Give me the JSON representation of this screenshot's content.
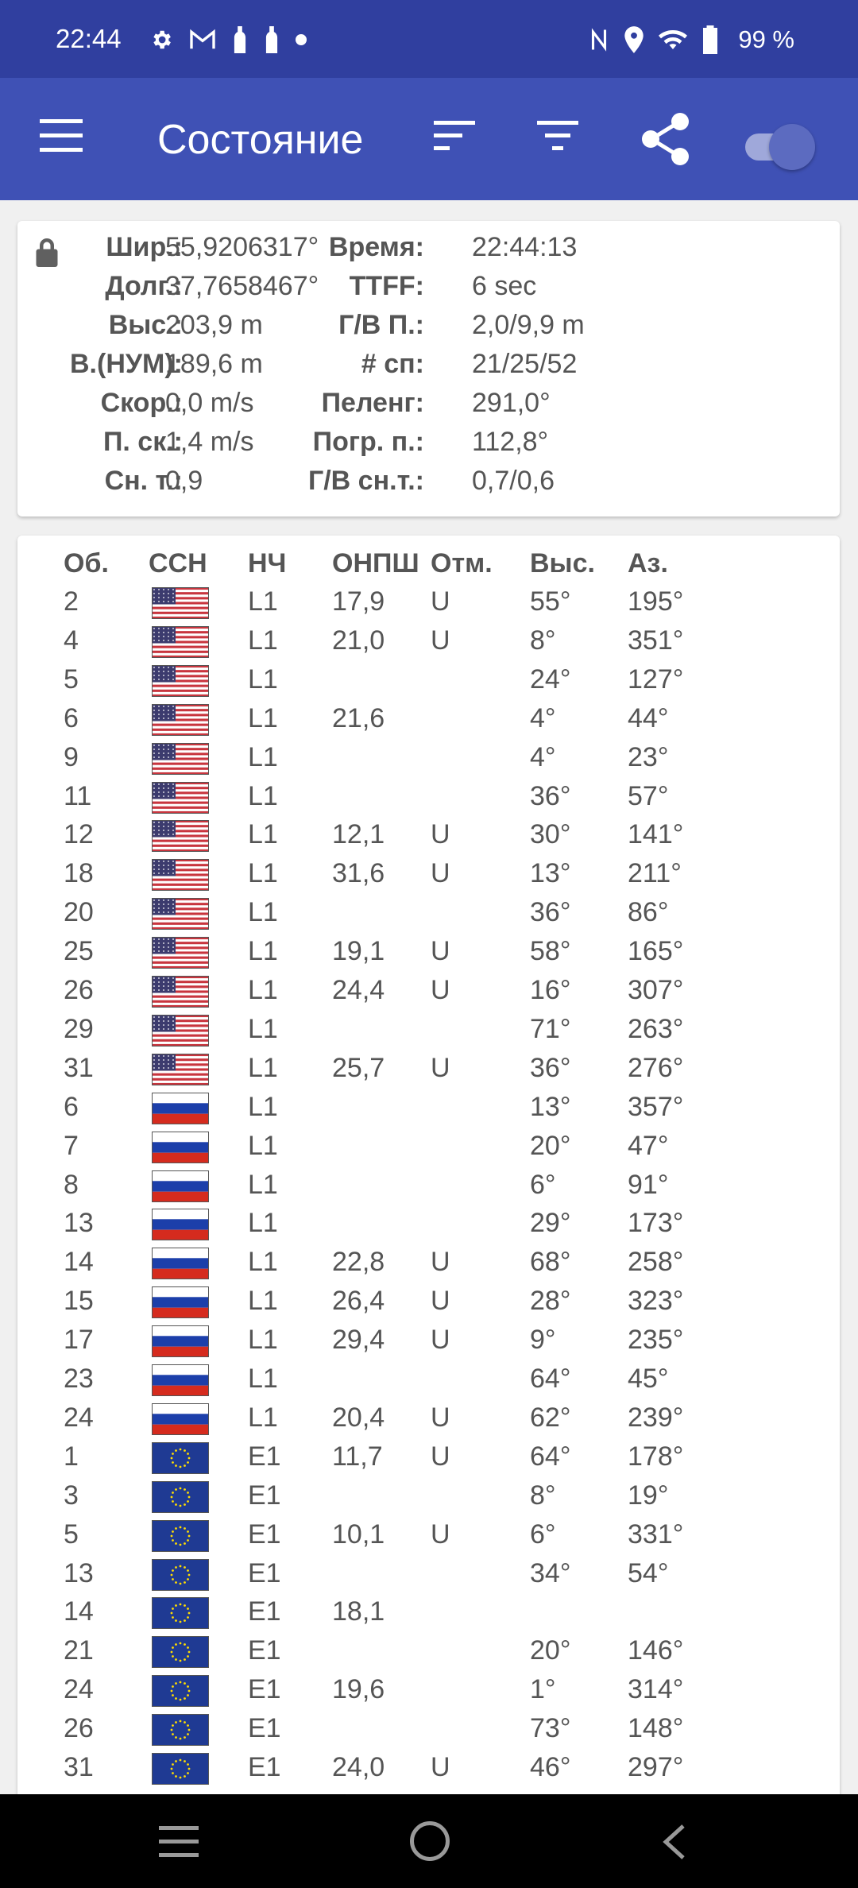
{
  "status_bar": {
    "time": "22:44",
    "battery": "99 %",
    "left_icons": [
      "gear-icon",
      "gmail-icon",
      "bottle-icon",
      "bottle-icon",
      "dot-icon"
    ],
    "right_icons": [
      "nfc-icon",
      "location-icon",
      "wifi-icon",
      "battery-icon"
    ]
  },
  "app_bar": {
    "title": "Состояние",
    "color": "#3f51b5",
    "status_color": "#303f9f",
    "actions": [
      "menu-icon",
      "sort-icon",
      "filter-icon",
      "share-icon",
      "toggle-switch"
    ],
    "toggle_on": true
  },
  "info": {
    "left": [
      {
        "label": "Шир.:",
        "value": "55,9206317°"
      },
      {
        "label": "Долг.:",
        "value": "37,7658467°"
      },
      {
        "label": "Выс.:",
        "value": "203,9 m"
      },
      {
        "label": "В.(НУМ):",
        "value": "189,6 m"
      },
      {
        "label": "Скор.:",
        "value": "0,0 m/s"
      },
      {
        "label": "П. ск.:",
        "value": "1,4 m/s"
      },
      {
        "label": "Сн. т.:",
        "value": "0,9"
      }
    ],
    "right": [
      {
        "label": "Время:",
        "value": "22:44:13"
      },
      {
        "label": "TTFF:",
        "value": "6 sec"
      },
      {
        "label": "Г/В П.:",
        "value": "2,0/9,9 m"
      },
      {
        "label": "# сп:",
        "value": "21/25/52"
      },
      {
        "label": "Пеленг:",
        "value": "291,0°"
      },
      {
        "label": "Погр. п.:",
        "value": "112,8°"
      },
      {
        "label": "Г/В сн.т.:",
        "value": "0,7/0,6"
      }
    ]
  },
  "satellites": {
    "headers": [
      "Об.",
      "ССН",
      "НЧ",
      "ОНПШ",
      "Отм.",
      "Выс.",
      "Аз."
    ],
    "rows": [
      {
        "id": "2",
        "gnss": "usa",
        "freq": "L1",
        "cn0": "17,9",
        "flag": "U",
        "elev": "55°",
        "azim": "195°"
      },
      {
        "id": "4",
        "gnss": "usa",
        "freq": "L1",
        "cn0": "21,0",
        "flag": "U",
        "elev": "8°",
        "azim": "351°"
      },
      {
        "id": "5",
        "gnss": "usa",
        "freq": "L1",
        "cn0": "",
        "flag": "",
        "elev": "24°",
        "azim": "127°"
      },
      {
        "id": "6",
        "gnss": "usa",
        "freq": "L1",
        "cn0": "21,6",
        "flag": "",
        "elev": "4°",
        "azim": "44°"
      },
      {
        "id": "9",
        "gnss": "usa",
        "freq": "L1",
        "cn0": "",
        "flag": "",
        "elev": "4°",
        "azim": "23°"
      },
      {
        "id": "11",
        "gnss": "usa",
        "freq": "L1",
        "cn0": "",
        "flag": "",
        "elev": "36°",
        "azim": "57°"
      },
      {
        "id": "12",
        "gnss": "usa",
        "freq": "L1",
        "cn0": "12,1",
        "flag": "U",
        "elev": "30°",
        "azim": "141°"
      },
      {
        "id": "18",
        "gnss": "usa",
        "freq": "L1",
        "cn0": "31,6",
        "flag": "U",
        "elev": "13°",
        "azim": "211°"
      },
      {
        "id": "20",
        "gnss": "usa",
        "freq": "L1",
        "cn0": "",
        "flag": "",
        "elev": "36°",
        "azim": "86°"
      },
      {
        "id": "25",
        "gnss": "usa",
        "freq": "L1",
        "cn0": "19,1",
        "flag": "U",
        "elev": "58°",
        "azim": "165°"
      },
      {
        "id": "26",
        "gnss": "usa",
        "freq": "L1",
        "cn0": "24,4",
        "flag": "U",
        "elev": "16°",
        "azim": "307°"
      },
      {
        "id": "29",
        "gnss": "usa",
        "freq": "L1",
        "cn0": "",
        "flag": "",
        "elev": "71°",
        "azim": "263°"
      },
      {
        "id": "31",
        "gnss": "usa",
        "freq": "L1",
        "cn0": "25,7",
        "flag": "U",
        "elev": "36°",
        "azim": "276°"
      },
      {
        "id": "6",
        "gnss": "russia",
        "freq": "L1",
        "cn0": "",
        "flag": "",
        "elev": "13°",
        "azim": "357°"
      },
      {
        "id": "7",
        "gnss": "russia",
        "freq": "L1",
        "cn0": "",
        "flag": "",
        "elev": "20°",
        "azim": "47°"
      },
      {
        "id": "8",
        "gnss": "russia",
        "freq": "L1",
        "cn0": "",
        "flag": "",
        "elev": "6°",
        "azim": "91°"
      },
      {
        "id": "13",
        "gnss": "russia",
        "freq": "L1",
        "cn0": "",
        "flag": "",
        "elev": "29°",
        "azim": "173°"
      },
      {
        "id": "14",
        "gnss": "russia",
        "freq": "L1",
        "cn0": "22,8",
        "flag": "U",
        "elev": "68°",
        "azim": "258°"
      },
      {
        "id": "15",
        "gnss": "russia",
        "freq": "L1",
        "cn0": "26,4",
        "flag": "U",
        "elev": "28°",
        "azim": "323°"
      },
      {
        "id": "17",
        "gnss": "russia",
        "freq": "L1",
        "cn0": "29,4",
        "flag": "U",
        "elev": "9°",
        "azim": "235°"
      },
      {
        "id": "23",
        "gnss": "russia",
        "freq": "L1",
        "cn0": "",
        "flag": "",
        "elev": "64°",
        "azim": "45°"
      },
      {
        "id": "24",
        "gnss": "russia",
        "freq": "L1",
        "cn0": "20,4",
        "flag": "U",
        "elev": "62°",
        "azim": "239°"
      },
      {
        "id": "1",
        "gnss": "eu",
        "freq": "E1",
        "cn0": "11,7",
        "flag": "U",
        "elev": "64°",
        "azim": "178°"
      },
      {
        "id": "3",
        "gnss": "eu",
        "freq": "E1",
        "cn0": "",
        "flag": "",
        "elev": "8°",
        "azim": "19°"
      },
      {
        "id": "5",
        "gnss": "eu",
        "freq": "E1",
        "cn0": "10,1",
        "flag": "U",
        "elev": "6°",
        "azim": "331°"
      },
      {
        "id": "13",
        "gnss": "eu",
        "freq": "E1",
        "cn0": "",
        "flag": "",
        "elev": "34°",
        "azim": "54°"
      },
      {
        "id": "14",
        "gnss": "eu",
        "freq": "E1",
        "cn0": "18,1",
        "flag": "",
        "elev": "",
        "azim": ""
      },
      {
        "id": "21",
        "gnss": "eu",
        "freq": "E1",
        "cn0": "",
        "flag": "",
        "elev": "20°",
        "azim": "146°"
      },
      {
        "id": "24",
        "gnss": "eu",
        "freq": "E1",
        "cn0": "19,6",
        "flag": "",
        "elev": "1°",
        "azim": "314°"
      },
      {
        "id": "26",
        "gnss": "eu",
        "freq": "E1",
        "cn0": "",
        "flag": "",
        "elev": "73°",
        "azim": "148°"
      },
      {
        "id": "31",
        "gnss": "eu",
        "freq": "E1",
        "cn0": "24,0",
        "flag": "U",
        "elev": "46°",
        "azim": "297°"
      }
    ]
  },
  "nav_bar": {
    "buttons": [
      "recents-icon",
      "home-icon",
      "back-icon"
    ]
  }
}
